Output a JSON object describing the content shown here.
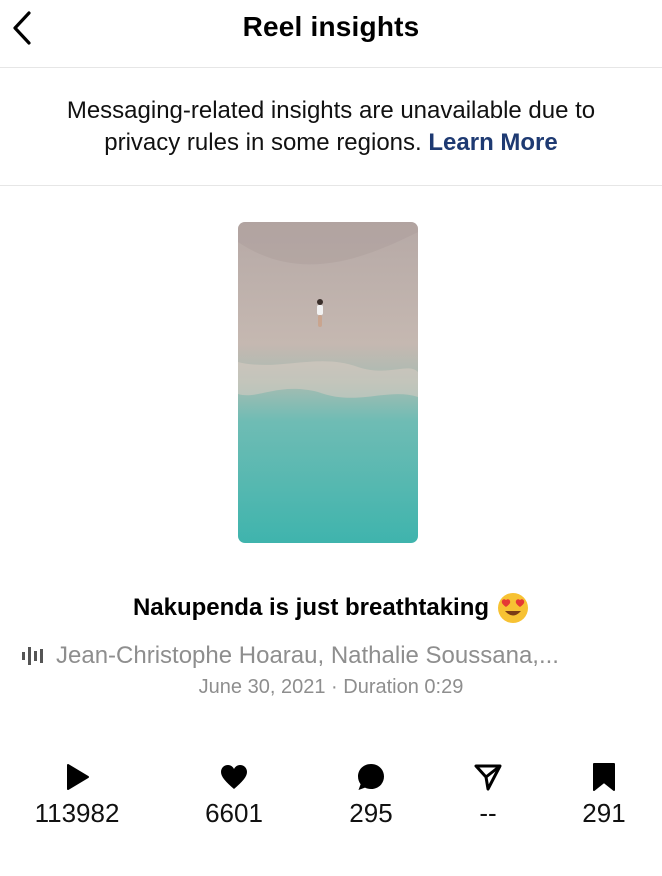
{
  "header": {
    "title": "Reel insights",
    "back_icon": "chevron-left-icon"
  },
  "notice": {
    "text": "Messaging-related insights are unavailable due to privacy rules in some regions.",
    "link": "Learn More",
    "link_color": "#1e3a72"
  },
  "reel": {
    "caption": "Nakupenda is just breathtaking",
    "caption_emoji": "heart-eyes-emoji",
    "audio": "Jean-Christophe Hoarau, Nathalie Soussana,...",
    "date": "June 30, 2021",
    "separator": "·",
    "duration": "Duration 0:29"
  },
  "stats": [
    {
      "icon": "play-icon",
      "value": "113982"
    },
    {
      "icon": "heart-icon",
      "value": "6601"
    },
    {
      "icon": "comment-icon",
      "value": "295"
    },
    {
      "icon": "share-icon",
      "value": "--"
    },
    {
      "icon": "bookmark-icon",
      "value": "291"
    }
  ],
  "colors": {
    "muted": "#8e8e8e",
    "divider": "#e6e6e6"
  }
}
